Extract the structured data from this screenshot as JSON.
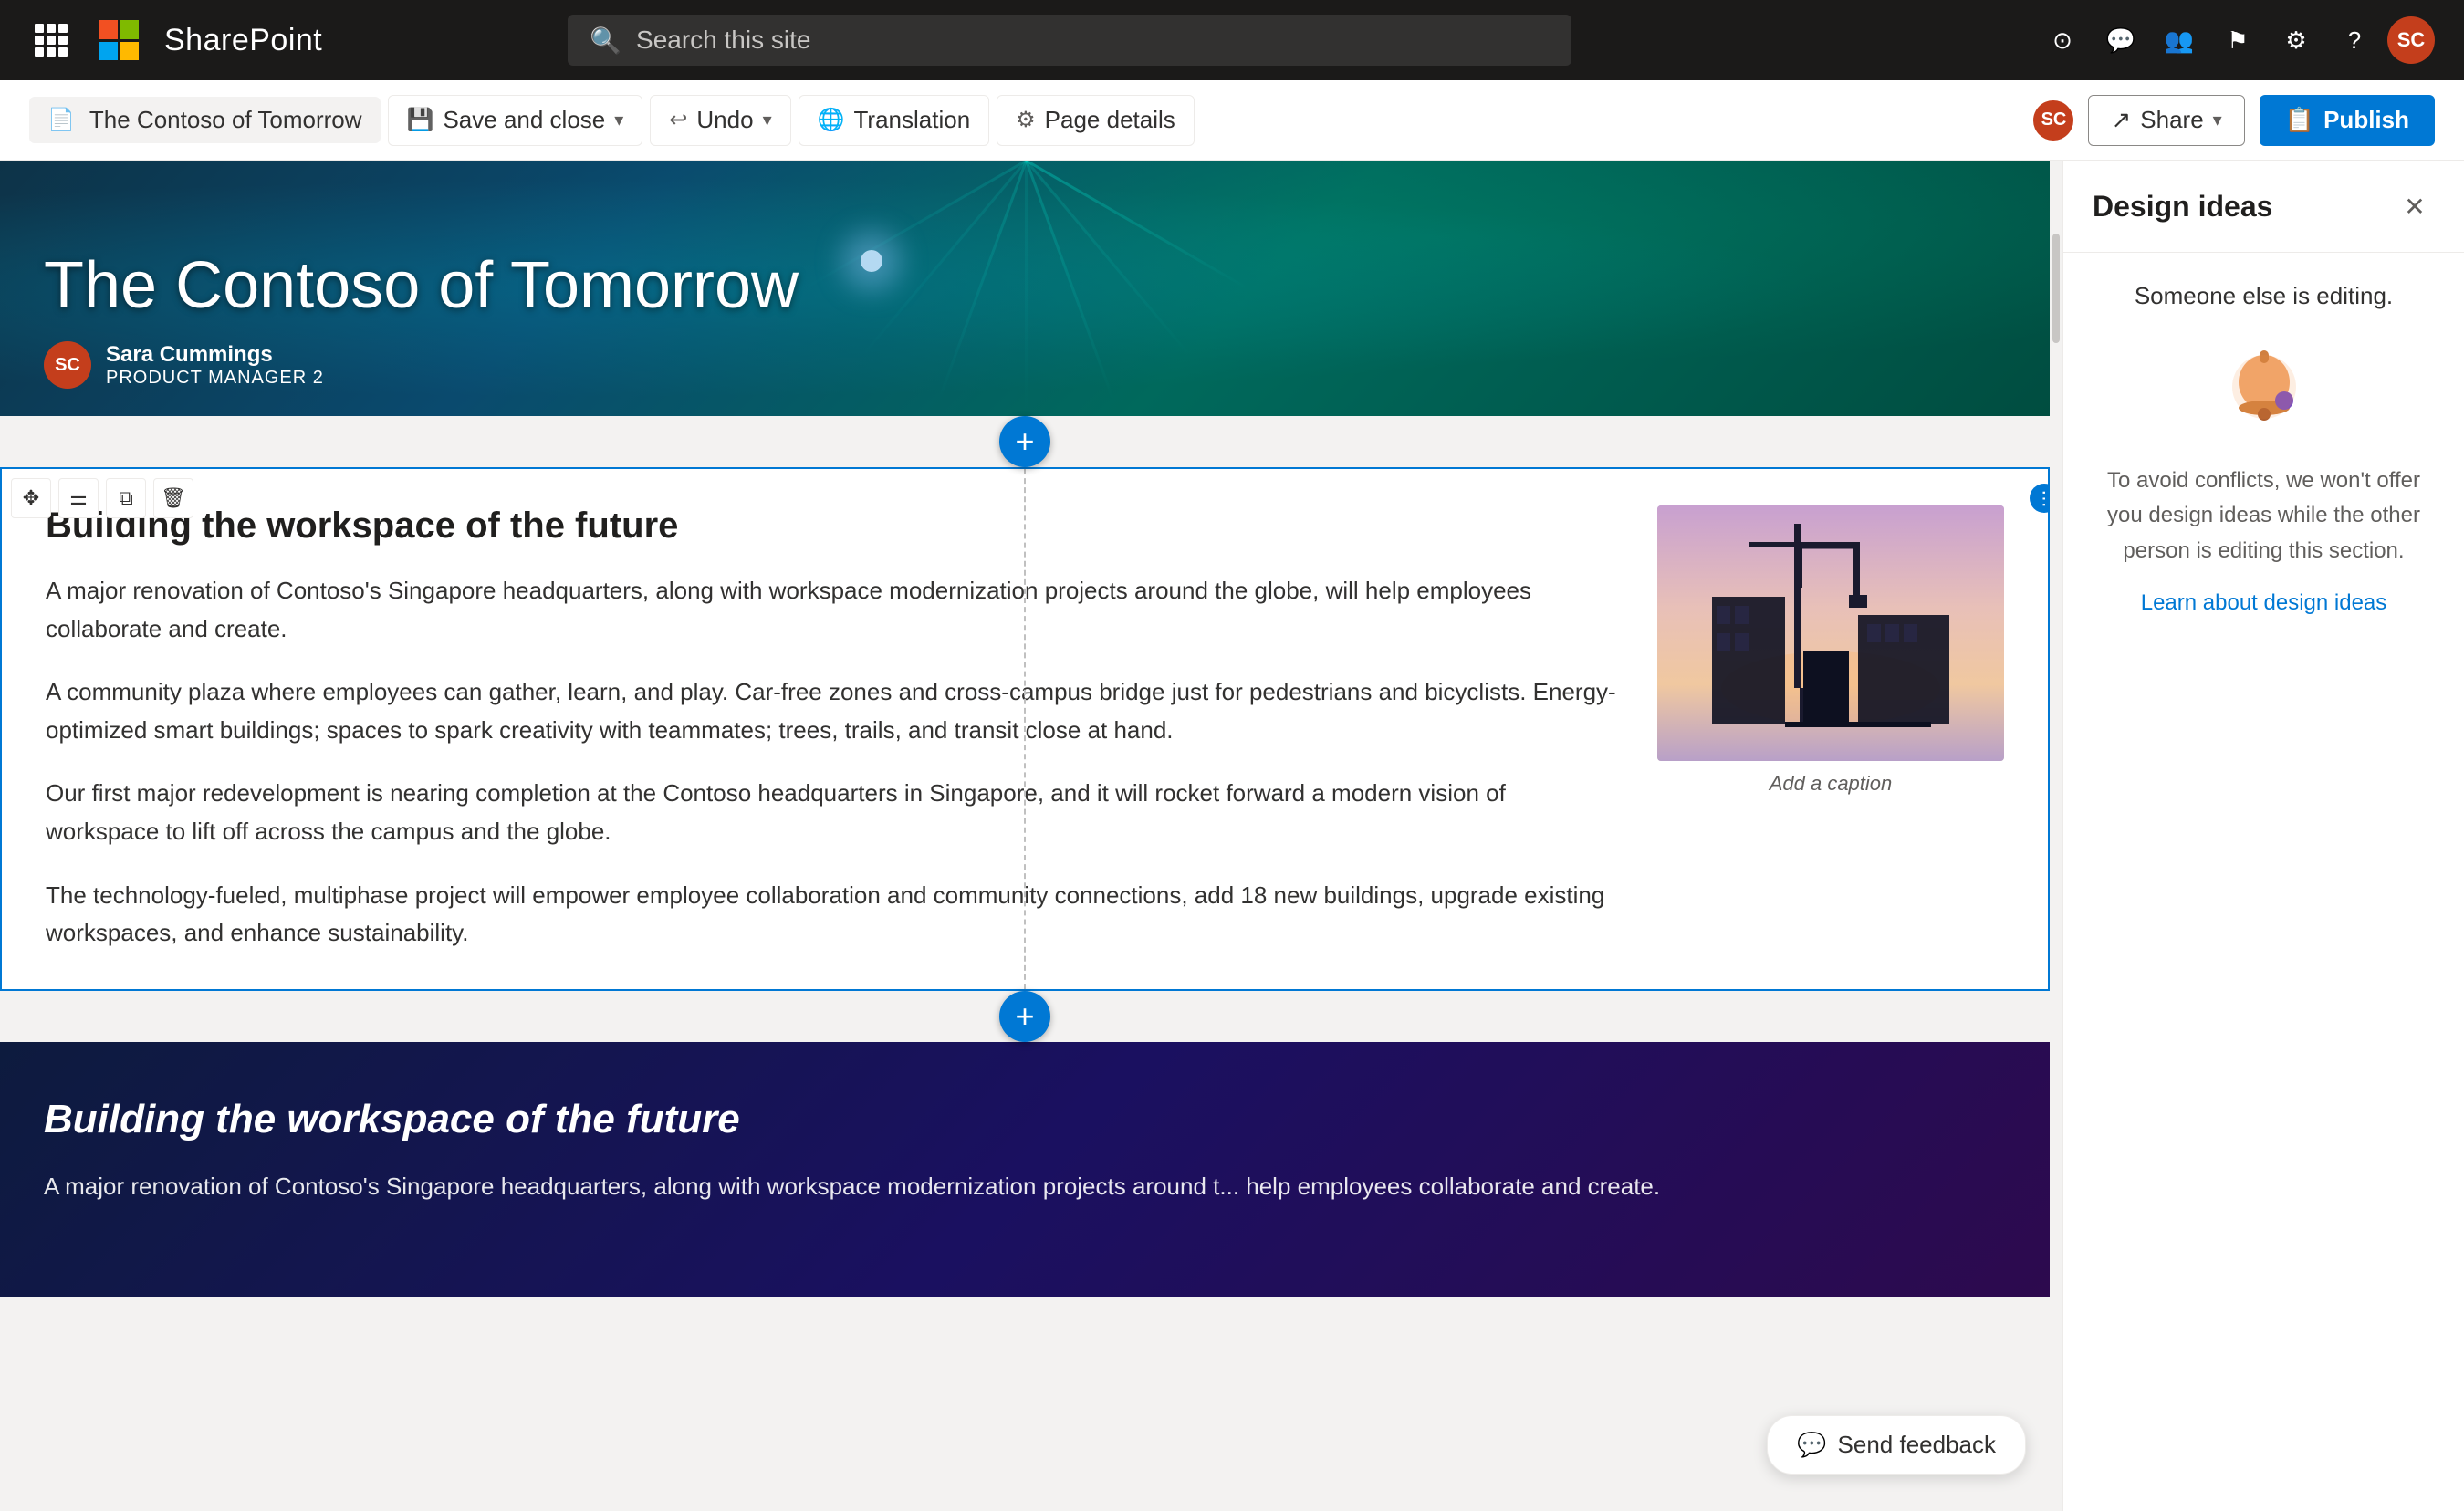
{
  "nav": {
    "app_name": "SharePoint",
    "search_placeholder": "Search this site",
    "icons": [
      "question-circle",
      "settings",
      "flag",
      "people",
      "chat",
      "help"
    ]
  },
  "toolbar": {
    "page_label": "The Contoso of Tomorrow",
    "save_close": "Save and close",
    "undo": "Undo",
    "translation": "Translation",
    "page_details": "Page details",
    "share": "Share",
    "publish": "Publish"
  },
  "hero": {
    "title": "The Contoso of Tomorrow",
    "author_name": "Sara Cummings",
    "author_role": "PRODUCT MANAGER 2",
    "author_initials": "SC"
  },
  "content_section": {
    "heading": "Building the workspace of the future",
    "paragraph1": "A major renovation of Contoso's Singapore headquarters, along with workspace modernization projects around the globe, will help employees collaborate and create.",
    "paragraph2": "A community plaza where employees can gather, learn, and play. Car-free zones and cross-campus bridge just for pedestrians and bicyclists. Energy-optimized smart buildings; spaces to spark creativity with teammates; trees, trails, and transit close at hand.",
    "paragraph3": "Our first major redevelopment is nearing completion at the Contoso headquarters in Singapore, and it will rocket forward a modern vision of workspace to lift off across the campus and the globe.",
    "paragraph4": "The technology-fueled, multiphase project will empower employee collaboration and community connections, add 18 new buildings, upgrade existing workspaces, and enhance sustainability.",
    "image_caption": "Add a caption"
  },
  "dark_section": {
    "heading": "Building the workspace of the future",
    "paragraph": "A major renovation of Contoso's Singapore headquarters, along with workspace modernization projects around t... help employees collaborate and create."
  },
  "design_ideas": {
    "panel_title": "Design ideas",
    "notice": "Someone else is editing.",
    "description": "To avoid conflicts, we won't offer you design ideas while the other person is editing this section.",
    "learn_link": "Learn about design ideas"
  },
  "feedback": {
    "label": "Send feedback"
  }
}
